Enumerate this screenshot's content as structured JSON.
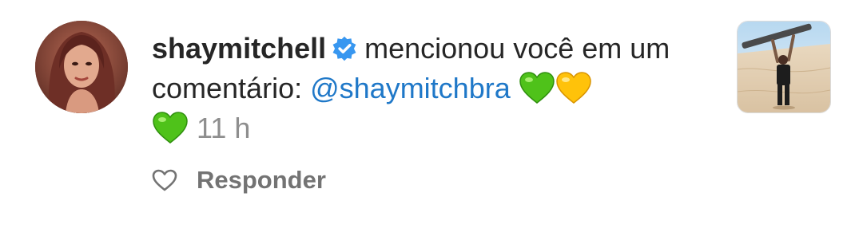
{
  "notification": {
    "username": "shaymitchell",
    "text_before_mention": "mencionou você em um comentário:",
    "mention": "@shaymitchbra",
    "time": "11 h",
    "reply_label": "Responder"
  },
  "icons": {
    "verified": "verified-badge-icon",
    "green_heart": "green-heart-emoji",
    "yellow_heart": "yellow-heart-emoji",
    "like": "heart-outline-icon"
  },
  "colors": {
    "text": "#262626",
    "mention": "#1f78c8",
    "muted": "#8e8e8e",
    "verified": "#3897f0"
  }
}
